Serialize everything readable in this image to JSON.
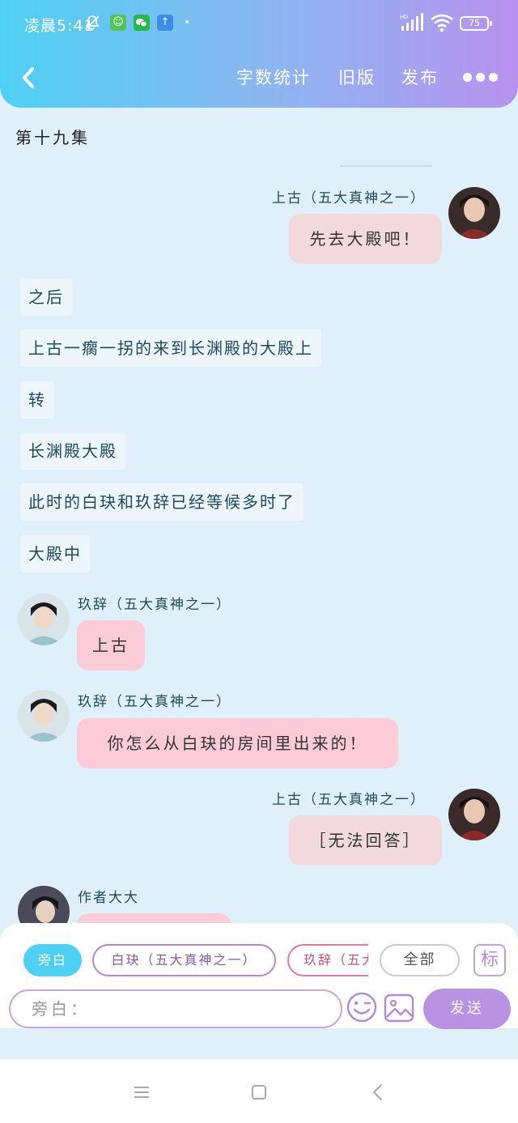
{
  "status_bar": {
    "time": "凌晨5:41",
    "battery": "75",
    "network": "HD",
    "icons": [
      "muted-bell-icon",
      "app-icon",
      "wechat-icon",
      "upload-icon",
      "dot-icon",
      "signal-icon",
      "wifi-icon",
      "battery-icon"
    ]
  },
  "nav": {
    "back_icon": "chevron-left-icon",
    "word_count": "字数统计",
    "old_version": "旧版",
    "publish": "发布",
    "more_icon": "more-dots-icon"
  },
  "chapter_title": "第十九集",
  "messages": [
    {
      "type": "right",
      "speaker": "上古（五大真神之一）",
      "text": "先去大殿吧！"
    },
    {
      "type": "narration",
      "text": "之后"
    },
    {
      "type": "narration",
      "text": "上古一瘸一拐的来到长渊殿的大殿上"
    },
    {
      "type": "narration",
      "text": "转"
    },
    {
      "type": "narration",
      "text": "长渊殿大殿"
    },
    {
      "type": "narration",
      "text": "此时的白玦和玖辞已经等候多时了"
    },
    {
      "type": "narration",
      "text": "大殿中"
    },
    {
      "type": "left",
      "speaker": "玖辞（五大真神之一）",
      "text": "上古"
    },
    {
      "type": "left",
      "speaker": "玖辞（五大真神之一）",
      "text": "你怎么从白玦的房间里出来的！"
    },
    {
      "type": "right",
      "speaker": "上古（五大真神之一）",
      "text": "［无法回答］"
    },
    {
      "type": "left",
      "speaker": "作者大大",
      "text": ""
    }
  ],
  "input_panel": {
    "roles": [
      "旁白",
      "白玦（五大真神之一）",
      "玖辞（五大真神之一）"
    ],
    "all": "全部",
    "mark": "标",
    "placeholder": "旁白：",
    "emoji_icon": "emoji-wink-icon",
    "image_icon": "image-icon",
    "send": "发送"
  },
  "system_nav": {
    "icons": [
      "menu-icon",
      "home-square-icon",
      "back-triangle-icon"
    ]
  },
  "colors": {
    "header_gradient_start": "#4fd0f2",
    "header_gradient_end": "#b792ee",
    "chat_background": "#dff0fa",
    "bubble_right": "#f2d9de",
    "bubble_left": "#fbcbd8",
    "send_button": "#b992e3"
  }
}
